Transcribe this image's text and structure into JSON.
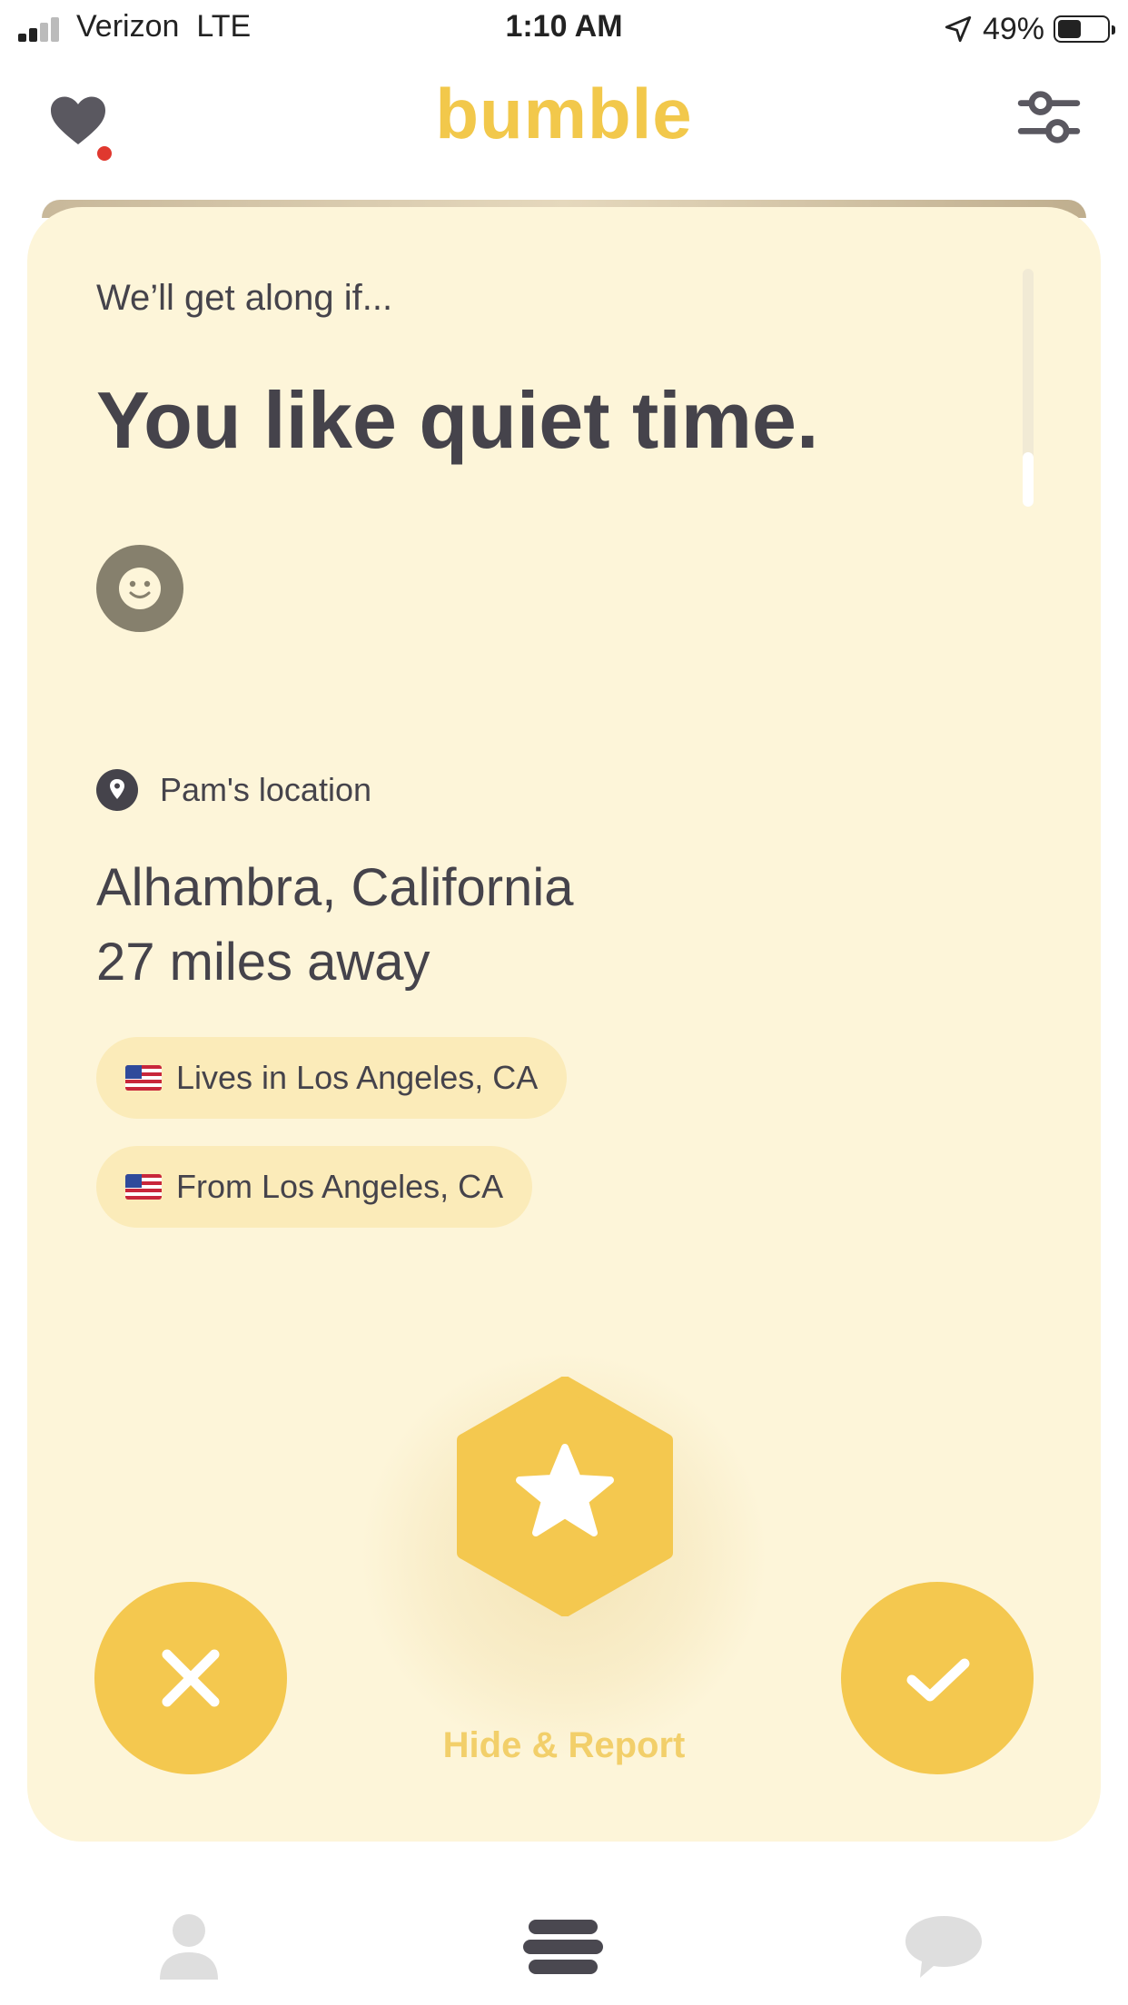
{
  "status_bar": {
    "carrier": "Verizon",
    "network": "LTE",
    "time": "1:10 AM",
    "battery_percent": "49%",
    "battery_level": 0.49,
    "signal_bars": 2,
    "icons": [
      "signal-icon",
      "location-arrow-icon",
      "battery-icon"
    ]
  },
  "header": {
    "logo": "bumble",
    "icons": [
      "heart-icon",
      "filter-icon"
    ],
    "notification_color": "#e0382f"
  },
  "profile_card": {
    "prompt_label": "We’ll get along if...",
    "prompt_answer": "You like quiet time.",
    "reaction_icon": "smiley-icon",
    "location_label": "Pam's location",
    "city": "Alhambra, California",
    "distance": "27 miles away",
    "badges": [
      {
        "flag": "us-flag-icon",
        "text": "Lives in Los Angeles, CA"
      },
      {
        "flag": "us-flag-icon",
        "text": "From Los Angeles, CA"
      }
    ],
    "background_color": "#fdf5d9"
  },
  "actions": {
    "pass_icon": "close-icon",
    "superswipe_icon": "star-icon",
    "like_icon": "check-icon",
    "hide_report_label": "Hide & Report",
    "accent_color": "#f4c84f"
  },
  "bottom_nav": {
    "items": [
      {
        "name": "profile",
        "icon": "person-icon"
      },
      {
        "name": "people",
        "icon": "bumble-stack-icon",
        "active": true
      },
      {
        "name": "chats",
        "icon": "chat-bubble-icon"
      }
    ]
  }
}
